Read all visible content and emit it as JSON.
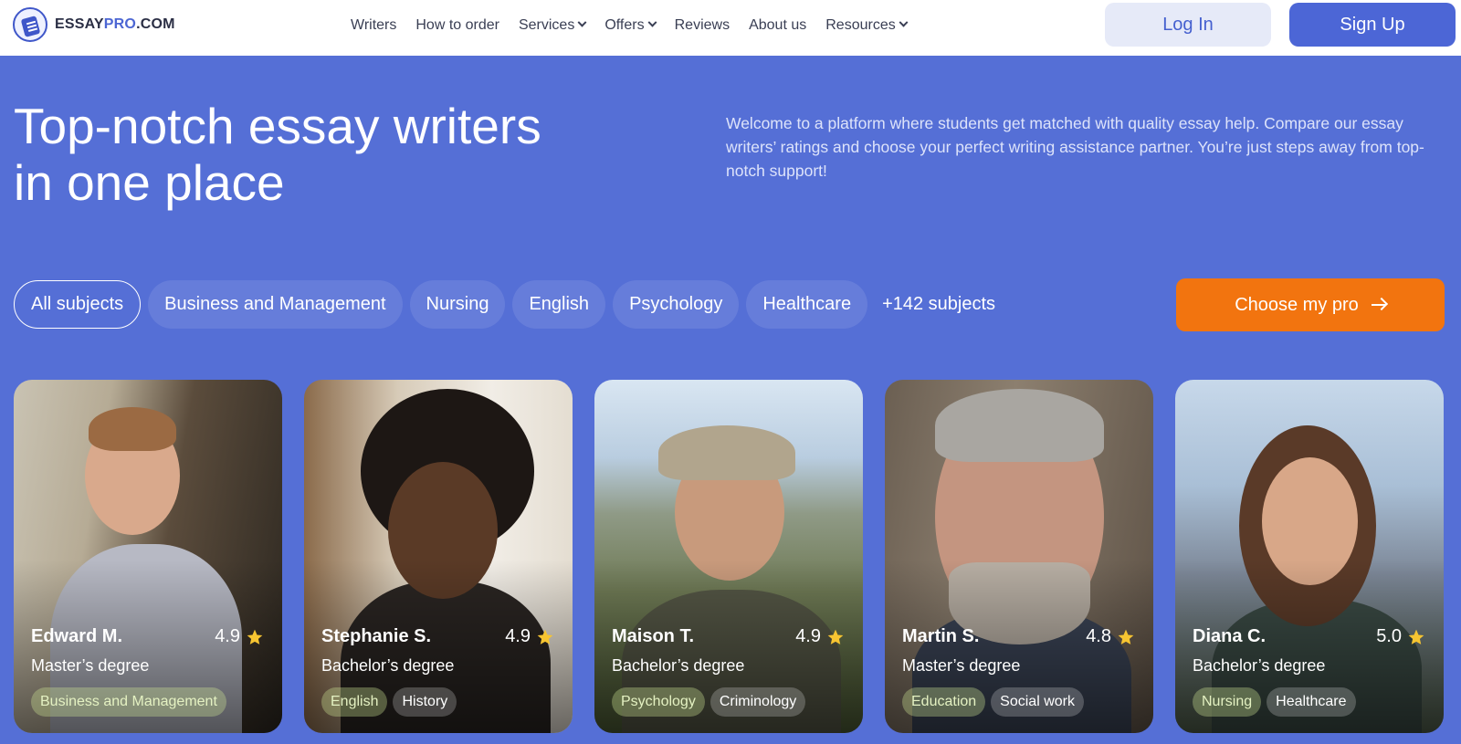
{
  "brand": {
    "name_prefix": "ESSAY",
    "name_accent": "PRO",
    "name_suffix": ".COM"
  },
  "nav": [
    {
      "label": "Writers",
      "dropdown": false
    },
    {
      "label": "How to order",
      "dropdown": false
    },
    {
      "label": "Services",
      "dropdown": true
    },
    {
      "label": "Offers",
      "dropdown": true
    },
    {
      "label": "Reviews",
      "dropdown": false
    },
    {
      "label": "About us",
      "dropdown": false
    },
    {
      "label": "Resources",
      "dropdown": true
    }
  ],
  "auth": {
    "login_label": "Log In",
    "signup_label": "Sign Up"
  },
  "hero": {
    "title_line1": "Top-notch essay writers",
    "title_line2": "in one place",
    "description": "Welcome to a platform where students get matched with quality essay help. Compare our essay writers’ ratings and choose your perfect writing assistance partner. You’re just steps away from top-notch support!"
  },
  "subjects": {
    "chips": [
      "All subjects",
      "Business and Management",
      "Nursing",
      "English",
      "Psychology",
      "Healthcare"
    ],
    "active_index": 0,
    "more_label": "+142 subjects"
  },
  "cta": {
    "label": "Choose my pro"
  },
  "writers": [
    {
      "name": "Edward M.",
      "rating": "4.9",
      "degree": "Master’s degree",
      "tags": [
        "Business and Management"
      ]
    },
    {
      "name": "Stephanie S.",
      "rating": "4.9",
      "degree": "Bachelor’s degree",
      "tags": [
        "English",
        "History"
      ]
    },
    {
      "name": "Maison T.",
      "rating": "4.9",
      "degree": "Bachelor’s degree",
      "tags": [
        "Psychology",
        "Criminology"
      ]
    },
    {
      "name": "Martin S.",
      "rating": "4.8",
      "degree": "Master’s degree",
      "tags": [
        "Education",
        "Social work"
      ]
    },
    {
      "name": "Diana C.",
      "rating": "5.0",
      "degree": "Bachelor’s degree",
      "tags": [
        "Nursing",
        "Healthcare"
      ]
    }
  ],
  "colors": {
    "hero_bg": "#556fd6",
    "primary": "#4c66d6",
    "cta_orange": "#f2740f",
    "star": "#f7c531"
  }
}
